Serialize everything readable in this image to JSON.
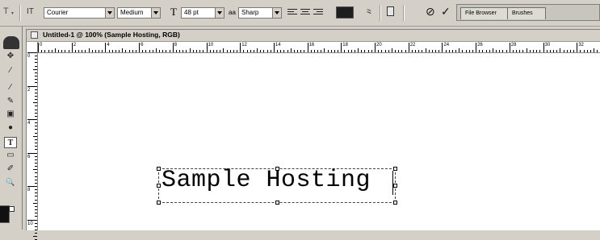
{
  "options_bar": {
    "tool_preset_label": "T",
    "orientation_label": "IT",
    "font_family": "Courier",
    "font_style": "Medium",
    "font_size_icon": "T",
    "font_size": "48 pt",
    "antialias_icon": "aa",
    "antialias": "Sharp",
    "text_color": "#1e1e1e",
    "cancel_glyph": "⊘",
    "commit_glyph": "✓",
    "palette_tabs": [
      "File Browser",
      "Brushes"
    ]
  },
  "toolbox": {
    "tools": [
      "⟲",
      "✥",
      "∕",
      "⁄",
      "✎",
      "✂",
      "▣",
      "●",
      "T",
      "▭",
      "✐",
      "🔍"
    ]
  },
  "document": {
    "title": "Untitled-1 @ 100% (Sample Hosting, RGB)",
    "typed_text": "Sample Hosting",
    "h_ruler_labels": [
      "0",
      "2",
      "4",
      "6",
      "8",
      "10",
      "12",
      "14",
      "16",
      "18",
      "20",
      "22",
      "24",
      "26",
      "28",
      "30",
      "32"
    ],
    "v_ruler_labels": [
      "0",
      "2",
      "4",
      "6",
      "8",
      "10"
    ]
  }
}
